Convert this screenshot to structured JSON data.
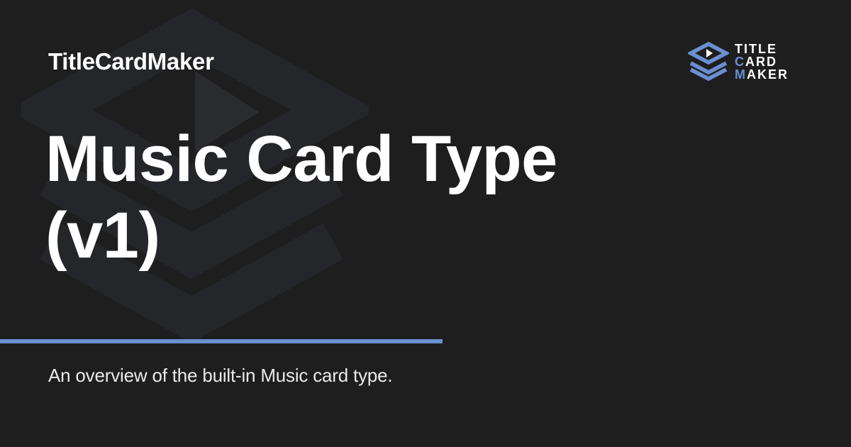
{
  "header": {
    "site_name": "TitleCardMaker"
  },
  "main": {
    "title": "Music Card Type (v1)",
    "description": "An overview of the built-in Music card type."
  },
  "brand": {
    "lines": [
      {
        "first": "T",
        "rest": "ITLE"
      },
      {
        "first": "C",
        "rest": "ARD"
      },
      {
        "first": "M",
        "rest": "AKER"
      }
    ],
    "logo_icon": "layered-play-icon"
  },
  "colors": {
    "background": "#1e1e1f",
    "accent": "#6a8fd0",
    "watermark": "#26272a",
    "text": "#ffffff"
  }
}
